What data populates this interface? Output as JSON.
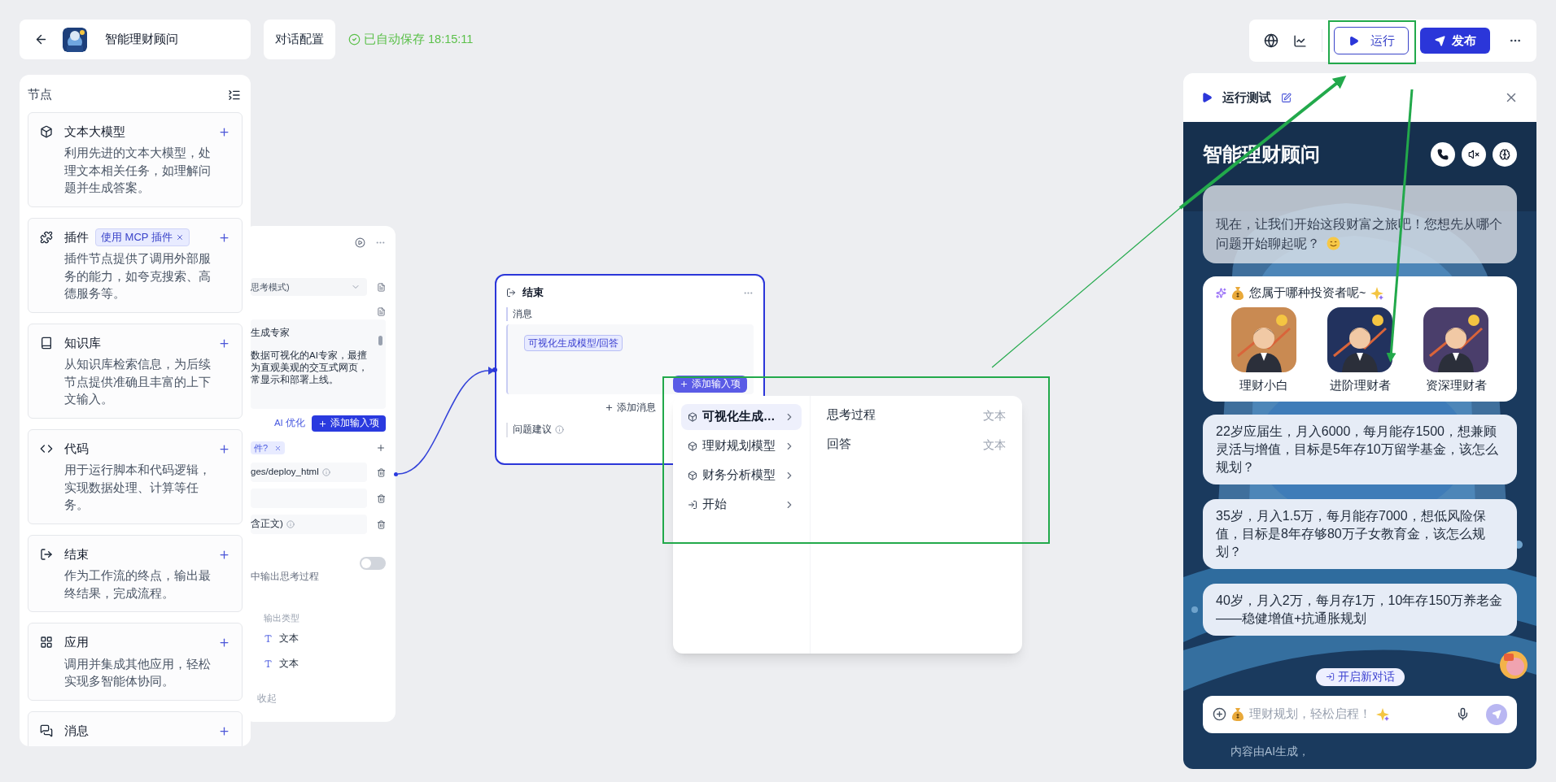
{
  "app": {
    "title": "智能理财顾问"
  },
  "config_button": "对话配置",
  "save_status": "已自动保存 18:15:11",
  "toolbar": {
    "run": "运行",
    "publish": "发布"
  },
  "node_panel": {
    "title": "节点",
    "items": [
      {
        "kind": "llm",
        "title": "文本大模型",
        "description": "利用先进的文本大模型，处理文本相关任务，如理解问题并生成答案。"
      },
      {
        "kind": "plugin",
        "title": "插件",
        "tag": "使用 MCP 插件",
        "description": "插件节点提供了调用外部服务的能力，如夸克搜索、高德服务等。"
      },
      {
        "kind": "knowledge",
        "title": "知识库",
        "description": "从知识库检索信息，为后续节点提供准确且丰富的上下文输入。"
      },
      {
        "kind": "code",
        "title": "代码",
        "description": "用于运行脚本和代码逻辑，实现数据处理、计算等任务。"
      },
      {
        "kind": "end",
        "title": "结束",
        "description": "作为工作流的终点，输出最终结果，完成流程。"
      },
      {
        "kind": "app",
        "title": "应用",
        "description": "调用并集成其他应用，轻松实现多智能体协同。"
      },
      {
        "kind": "message",
        "title": "消息"
      }
    ]
  },
  "llm_node": {
    "model_select": "思考模式)",
    "prompt_title": "生成专家",
    "prompt_lines": [
      "数据可视化的AI专家，最擅",
      "为直观美观的交互式网页，",
      "常显示和部署上线。"
    ],
    "ai_optimize": "AI 优化",
    "add_input": "添加输入项",
    "input_tag": "件?",
    "input_rows": [
      {
        "kind": "field",
        "text": "ges/deploy_html"
      },
      {
        "kind": "blank"
      },
      {
        "kind": "field",
        "text": "含正文)"
      }
    ],
    "thinking_output": {
      "label": "中输出思考过程",
      "on": false
    },
    "output_header": "输出类型",
    "output_types": [
      "文本",
      "文本"
    ],
    "collapse": "收起"
  },
  "end_node": {
    "title": "结束",
    "selected": true,
    "message_label": "消息",
    "message_tag": "可视化生成模型/回答",
    "add_message": "添加消息",
    "suggestions_label": "问题建议"
  },
  "add_input_button": "添加输入项",
  "variable_menu": {
    "sources": [
      {
        "kind": "model",
        "label": "可视化生成…",
        "selected": true
      },
      {
        "kind": "model",
        "label": "理财规划模型",
        "selected": false
      },
      {
        "kind": "model",
        "label": "财务分析模型",
        "selected": false
      },
      {
        "kind": "start",
        "label": "开始",
        "selected": false
      }
    ],
    "fields": [
      {
        "name": "思考过程",
        "type": "文本"
      },
      {
        "name": "回答",
        "type": "文本"
      }
    ]
  },
  "run_panel": {
    "title": "运行测试",
    "chat_title": "智能理财顾问",
    "greeting": "现在，让我们开始这段财富之旅吧！您想先从哪个问题开始聊起呢？",
    "persona_question": "您属于哪种投资者呢~",
    "personas": [
      {
        "label": "理财小白"
      },
      {
        "label": "进阶理财者"
      },
      {
        "label": "资深理财者"
      }
    ],
    "suggestions": [
      "22岁应届生，月入6000，每月能存1500，想兼顾灵活与增值，目标是5年存10万留学基金，该怎么规划？",
      "35岁，月入1.5万，每月能存7000，想低风险保值，目标是8年存够80万子女教育金，该怎么规划？",
      "40岁，月入2万，每月存1万，10年存150万养老金——稳健增值+抗通胀规划"
    ],
    "new_chat": "开启新对话",
    "input_placeholder": "理财规划，轻松启程！",
    "disclaimer": "内容由AI生成，"
  }
}
